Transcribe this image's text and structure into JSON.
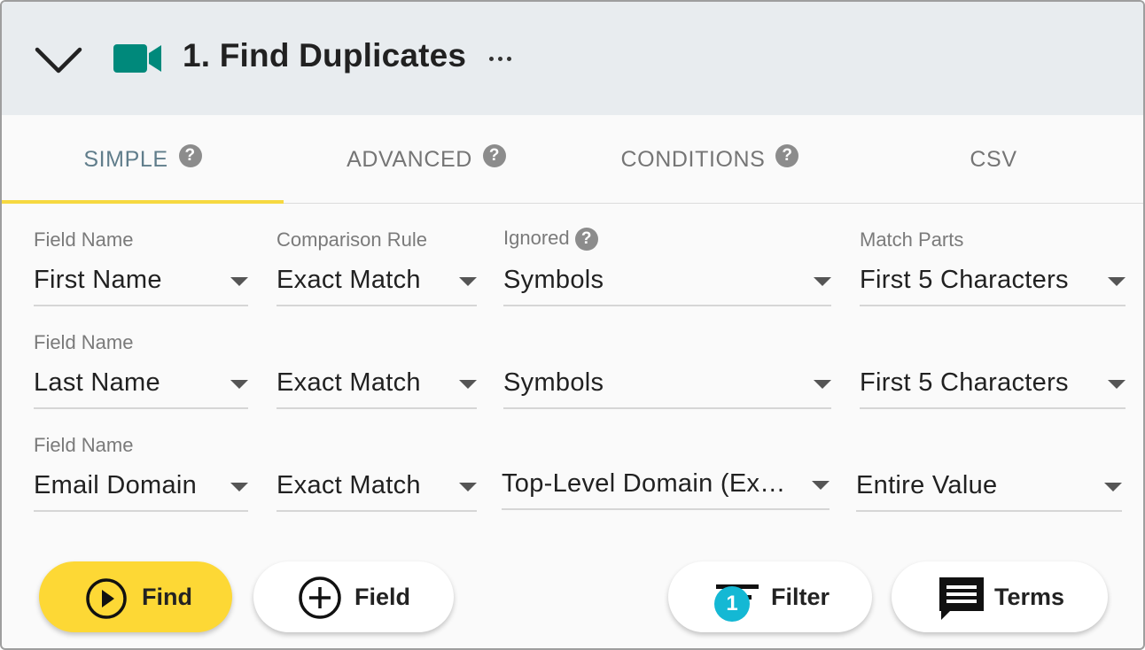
{
  "header": {
    "title": "1. Find Duplicates",
    "accent_color": "#00897b",
    "collapse_icon": "chevron-down-icon",
    "type_icon": "video-camera-icon",
    "more_icon": "more-horizontal-icon"
  },
  "tabs": [
    {
      "label": "SIMPLE",
      "help": "?",
      "active": true
    },
    {
      "label": "ADVANCED",
      "help": "?",
      "active": false
    },
    {
      "label": "CONDITIONS",
      "help": "?",
      "active": false
    },
    {
      "label": "CSV",
      "help": "",
      "active": false
    }
  ],
  "columns": {
    "field_name": "Field Name",
    "comparison_rule": "Comparison Rule",
    "ignored": "Ignored",
    "ignored_help": "?",
    "match_parts": "Match Parts"
  },
  "rows": [
    {
      "field_label": "Field Name",
      "field": "First Name",
      "rule": "Exact Match",
      "ignored": "Symbols",
      "match_parts": "First 5 Characters"
    },
    {
      "field_label": "Field Name",
      "field": "Last Name",
      "rule": "Exact Match",
      "ignored": "Symbols",
      "match_parts": "First 5 Characters"
    },
    {
      "field_label": "Field Name",
      "field": "Email Domain",
      "rule": "Exact Match",
      "ignored": "Top-Level Domain (Extension)",
      "match_parts": "Entire Value"
    }
  ],
  "buttons": {
    "find": "Find",
    "field": "Field",
    "filter": "Filter",
    "filter_badge": "1",
    "terms": "Terms"
  },
  "colors": {
    "primary_button": "#fdd835",
    "tab_indicator": "#f6d840",
    "badge": "#14b8d4",
    "active_tab": "#607d8b"
  }
}
